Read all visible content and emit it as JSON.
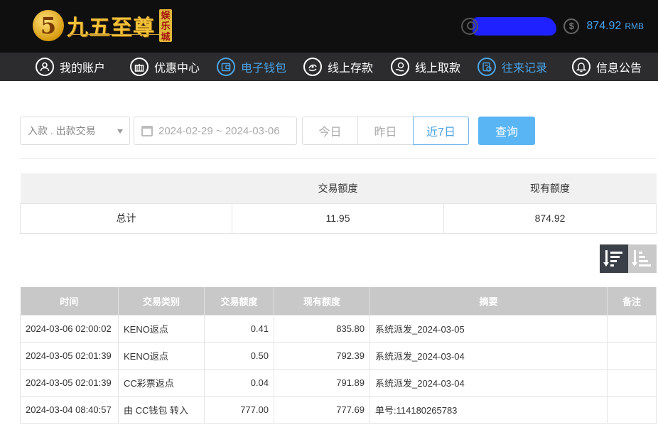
{
  "header": {
    "logo_mark": "5",
    "logo_text": "九五至尊",
    "logo_badge": [
      "娱",
      "乐",
      "城"
    ],
    "balance": "874.92",
    "currency": "RMB",
    "coin_symbol": "$"
  },
  "nav": [
    {
      "label": "我的账户",
      "icon": "user-icon",
      "active": false
    },
    {
      "label": "优惠中心",
      "icon": "gift-icon",
      "active": false
    },
    {
      "label": "电子钱包",
      "icon": "wallet-icon",
      "active": true
    },
    {
      "label": "线上存款",
      "icon": "deposit-icon",
      "active": false
    },
    {
      "label": "线上取款",
      "icon": "withdraw-icon",
      "active": false
    },
    {
      "label": "往来记录",
      "icon": "records-icon",
      "active": true
    },
    {
      "label": "信息公告",
      "icon": "bell-icon",
      "active": false
    }
  ],
  "filter": {
    "type_value": "入款 . 出款交易",
    "date_range": "2024-02-29 ~ 2024-03-06",
    "quick": [
      "今日",
      "昨日",
      "近7日"
    ],
    "quick_active": "近7日",
    "query_label": "查询"
  },
  "summary": {
    "headers": [
      "",
      "交易额度",
      "现有额度"
    ],
    "row": [
      "总计",
      "11.95",
      "874.92"
    ]
  },
  "transactions": {
    "headers": [
      "时间",
      "交易类别",
      "交易额度",
      "现有额度",
      "摘要",
      "备注"
    ],
    "rows": [
      [
        "2024-03-06 02:00:02",
        "KENO返点",
        "0.41",
        "835.80",
        "系统派发_2024-03-05",
        ""
      ],
      [
        "2024-03-05 02:01:39",
        "KENO返点",
        "0.50",
        "792.39",
        "系统派发_2024-03-04",
        ""
      ],
      [
        "2024-03-05 02:01:39",
        "CC彩票返点",
        "0.04",
        "791.89",
        "系统派发_2024-03-04",
        ""
      ],
      [
        "2024-03-04 08:40:57",
        "由 CC钱包 转入",
        "777.00",
        "777.69",
        "单号:114180265783",
        ""
      ]
    ]
  },
  "colors": {
    "accent": "#4aa3e6",
    "query_button": "#5ab5f4",
    "nav_bg": "#2c2c2e",
    "header_bg": "#0f0f10",
    "table_header": "#c8c8c8"
  }
}
